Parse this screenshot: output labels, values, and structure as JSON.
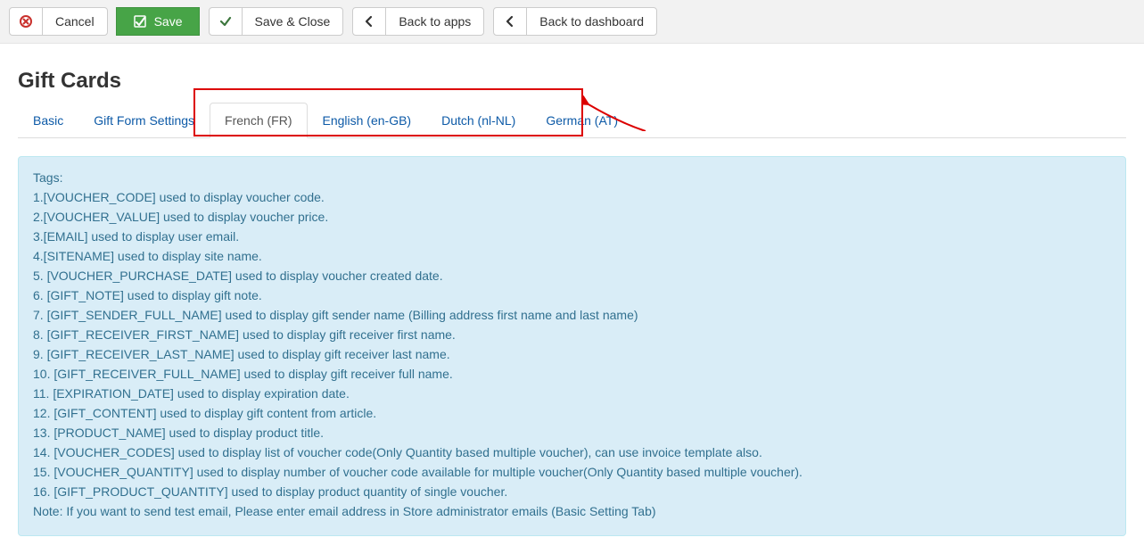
{
  "toolbar": {
    "cancel": "Cancel",
    "save": "Save",
    "save_close": "Save & Close",
    "back_apps": "Back to apps",
    "back_dashboard": "Back to dashboard"
  },
  "page_title": "Gift Cards",
  "tabs": {
    "basic": "Basic",
    "gift_form_settings": "Gift Form Settings",
    "french": "French (FR)",
    "english": "English (en-GB)",
    "dutch": "Dutch (nl-NL)",
    "german": "German (AT)"
  },
  "info": {
    "heading": "Tags:",
    "lines": {
      "l1": "1.[VOUCHER_CODE] used to display voucher code.",
      "l2": "2.[VOUCHER_VALUE] used to display voucher price.",
      "l3": "3.[EMAIL] used to display user email.",
      "l4": "4.[SITENAME] used to display site name.",
      "l5": "5. [VOUCHER_PURCHASE_DATE] used to display voucher created date.",
      "l6": "6. [GIFT_NOTE] used to display gift note.",
      "l7": "7. [GIFT_SENDER_FULL_NAME] used to display gift sender name (Billing address first name and last name)",
      "l8": "8. [GIFT_RECEIVER_FIRST_NAME] used to display gift receiver first name.",
      "l9": "9. [GIFT_RECEIVER_LAST_NAME] used to display gift receiver last name.",
      "l10": "10. [GIFT_RECEIVER_FULL_NAME] used to display gift receiver full name.",
      "l11": "11. [EXPIRATION_DATE] used to display expiration date.",
      "l12": "12. [GIFT_CONTENT] used to display gift content from article.",
      "l13": "13. [PRODUCT_NAME] used to display product title.",
      "l14": "14. [VOUCHER_CODES] used to display list of voucher code(Only Quantity based multiple voucher), can use invoice template also.",
      "l15": "15. [VOUCHER_QUANTITY] used to display number of voucher code available for multiple voucher(Only Quantity based multiple voucher).",
      "l16": "16. [GIFT_PRODUCT_QUANTITY] used to display product quantity of single voucher.",
      "note": "Note: If you want to send test email, Please enter email address in Store administrator emails (Basic Setting Tab)"
    }
  }
}
